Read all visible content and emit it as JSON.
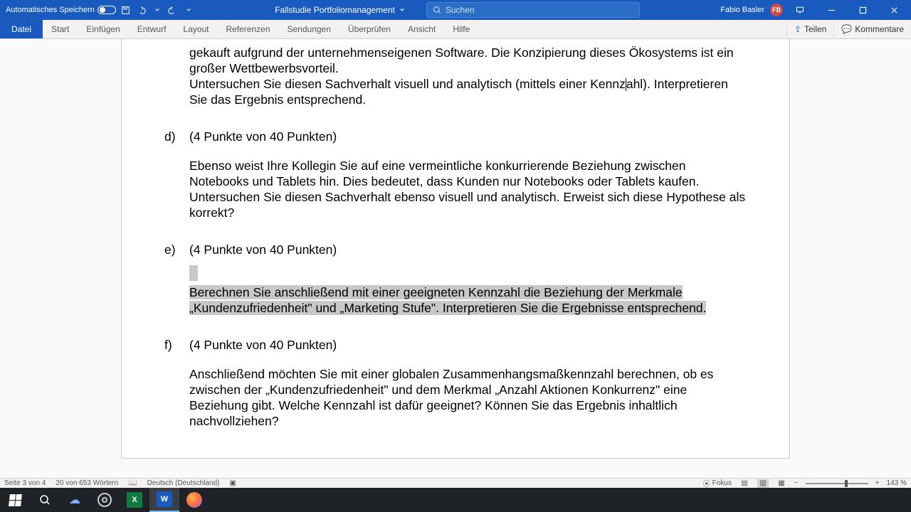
{
  "titlebar": {
    "autosave": "Automatisches Speichern",
    "doc_title": "Fallstudie Portfoliomanagement",
    "search_placeholder": "Suchen",
    "user_name": "Fabio Basler",
    "user_initials": "FB"
  },
  "ribbon": {
    "tabs": [
      "Datei",
      "Start",
      "Einfügen",
      "Entwurf",
      "Layout",
      "Referenzen",
      "Sendungen",
      "Überprüfen",
      "Ansicht",
      "Hilfe"
    ],
    "share": "Teilen",
    "comments": "Kommentare"
  },
  "doc": {
    "intro1": "gekauft aufgrund der unternehmenseigenen Software. Die Konzipierung dieses Ökosystems ist ein großer Wettbewerbsvorteil.",
    "intro2a": "Untersuchen Sie diesen Sachverhalt visuell und analytisch (mittels einer Kennz",
    "intro2b": "hl). Interpretieren Sie das Ergebnis entsprechend.",
    "d_label": "d)",
    "d_points": "(4 Punkte von 40 Punkten)",
    "d_body": "Ebenso weist Ihre Kollegin Sie auf eine vermeintliche konkurrierende Beziehung zwischen Notebooks und Tablets hin. Dies bedeutet, dass Kunden nur Notebooks oder Tablets kaufen. Untersuchen Sie diesen Sachverhalt ebenso visuell und analytisch. Erweist sich diese Hypothese als korrekt?",
    "e_label": "e)",
    "e_points": "(4 Punkte von 40 Punkten)",
    "e_body": "Berechnen Sie anschließend mit einer geeigneten Kennzahl die Beziehung der Merkmale „Kundenzufriedenheit\" und „Marketing Stufe\". Interpretieren Sie die Ergebnisse entsprechend.",
    "f_label": "f)",
    "f_points": "(4 Punkte von 40 Punkten)",
    "f_body": "Anschließend möchten Sie mit einer globalen Zusammenhangsmaßkennzahl berechnen, ob es zwischen der „Kundenzufriedenheit\" und dem Merkmal „Anzahl Aktionen Konkurrenz\" eine Beziehung gibt. Welche Kennzahl ist dafür geeignet? Können Sie das Ergebnis inhaltlich nachvollziehen?"
  },
  "status": {
    "page": "Seite 3 von 4",
    "words": "20 von 653 Wörtern",
    "lang": "Deutsch (Deutschland)",
    "focus": "Fokus",
    "zoom": "143 %"
  }
}
